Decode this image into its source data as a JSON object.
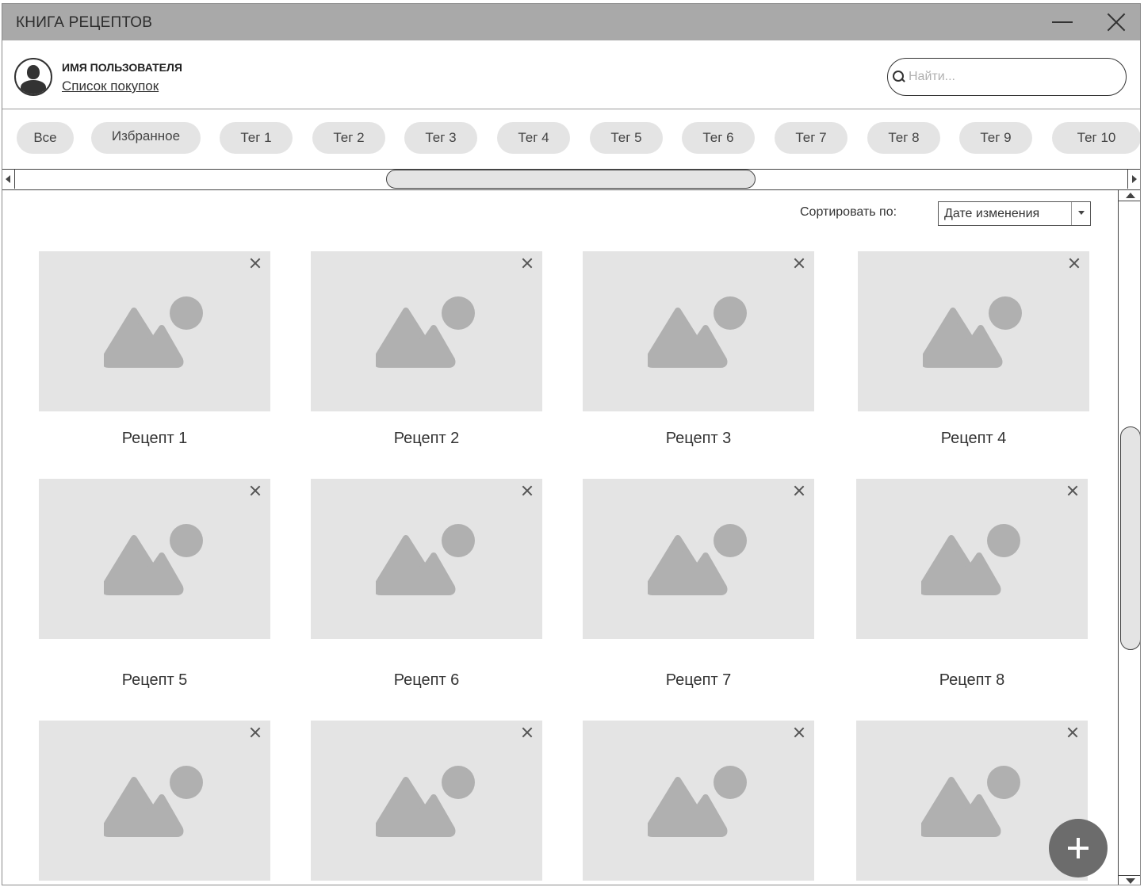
{
  "window": {
    "title": "КНИГА РЕЦЕПТОВ"
  },
  "header": {
    "username": "ИМЯ ПОЛЬЗОВАТЕЛЯ",
    "shopping_list": "Список покупок",
    "search_placeholder": "Найти..."
  },
  "tags": [
    "Все",
    "Избранное",
    "Тег 1",
    "Тег 2",
    "Тег 3",
    "Тег 4",
    "Тег 5",
    "Тег 6",
    "Тег 7",
    "Тег 8",
    "Тег 9",
    "Тег 10"
  ],
  "sort": {
    "label": "Сортировать по:",
    "value": "Дате изменения"
  },
  "recipes": [
    {
      "label": "Рецепт 1"
    },
    {
      "label": "Рецепт 2"
    },
    {
      "label": "Рецепт 3"
    },
    {
      "label": "Рецепт 4"
    },
    {
      "label": "Рецепт 5"
    },
    {
      "label": "Рецепт 6"
    },
    {
      "label": "Рецепт 7"
    },
    {
      "label": "Рецепт 8"
    },
    {
      "label": ""
    },
    {
      "label": ""
    },
    {
      "label": ""
    },
    {
      "label": ""
    }
  ],
  "colors": {
    "titlebar": "#a9a9a9",
    "tag": "#e4e4e4",
    "placeholder": "#e4e4e4",
    "placeholder_icon": "#b0b0b0",
    "fab": "#6c6c6c"
  },
  "icons": {
    "avatar": "user-icon",
    "search": "search-icon",
    "close": "close-icon",
    "add": "plus-icon",
    "image": "image-placeholder-icon"
  }
}
